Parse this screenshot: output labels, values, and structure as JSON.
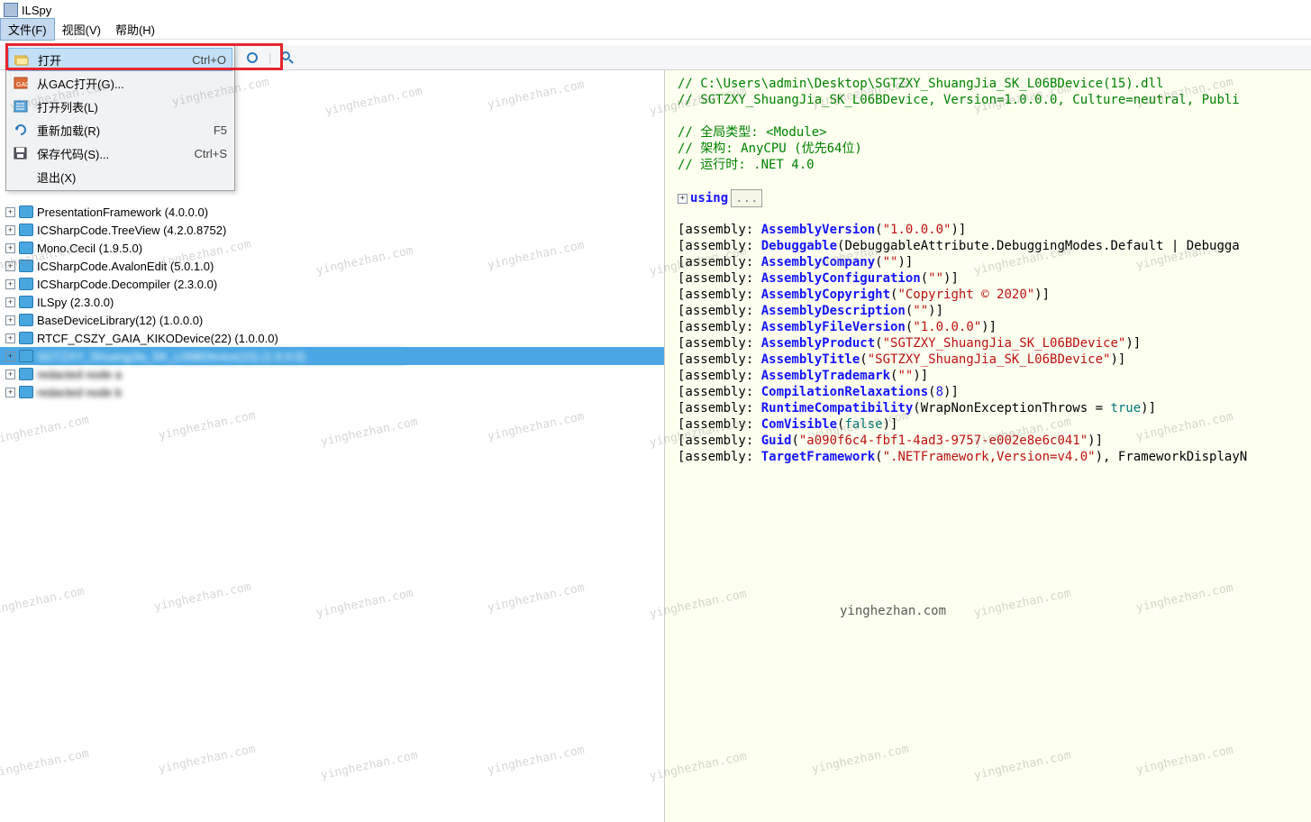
{
  "app": {
    "title": "ILSpy"
  },
  "menubar": {
    "items": [
      {
        "label": "文件(F)",
        "active": true
      },
      {
        "label": "视图(V)",
        "active": false
      },
      {
        "label": "帮助(H)",
        "active": false
      }
    ]
  },
  "fileMenu": {
    "items": [
      {
        "icon": "folder-open-icon",
        "label": "打开",
        "shortcut": "Ctrl+O",
        "hover": true
      },
      {
        "icon": "gac-icon",
        "label": "从GAC打开(G)...",
        "shortcut": ""
      },
      {
        "icon": "list-open-icon",
        "label": "打开列表(L)",
        "shortcut": ""
      },
      {
        "icon": "refresh-icon",
        "label": "重新加载(R)",
        "shortcut": "F5"
      },
      {
        "icon": "save-icon",
        "label": "保存代码(S)...",
        "shortcut": "Ctrl+S"
      },
      {
        "icon": "",
        "label": "退出(X)",
        "shortcut": ""
      }
    ]
  },
  "tree": {
    "nodes": [
      {
        "label": "PresentationFramework (4.0.0.0)",
        "state": "normal"
      },
      {
        "label": "ICSharpCode.TreeView (4.2.0.8752)",
        "state": "normal"
      },
      {
        "label": "Mono.Cecil (1.9.5.0)",
        "state": "normal"
      },
      {
        "label": "ICSharpCode.AvalonEdit (5.0.1.0)",
        "state": "normal"
      },
      {
        "label": "ICSharpCode.Decompiler (2.3.0.0)",
        "state": "normal"
      },
      {
        "label": "ILSpy (2.3.0.0)",
        "state": "normal"
      },
      {
        "label": "BaseDeviceLibrary(12) (1.0.0.0)",
        "state": "normal"
      },
      {
        "label": "RTCF_CSZY_GAIA_KIKODevice(22) (1.0.0.0)",
        "state": "normal"
      },
      {
        "label": "SGTZXY_ShuangJia_SK_L06BDevice(15) (1.0.0.0)",
        "state": "sel"
      },
      {
        "label": "redacted node a",
        "state": "blur"
      },
      {
        "label": "redacted node b",
        "state": "blur"
      }
    ]
  },
  "code": {
    "header": [
      "// C:\\Users\\admin\\Desktop\\SGTZXY_ShuangJia_SK_L06BDevice(15).dll",
      "// SGTZXY_ShuangJia_SK_L06BDevice, Version=1.0.0.0, Culture=neutral, Publi",
      "",
      "// 全局类型: <Module>",
      "// 架构: AnyCPU (优先64位)",
      "// 运行时: .NET 4.0"
    ],
    "usingWord": "using",
    "assemblyLines": [
      {
        "attr": "AssemblyVersion",
        "arg": "\"1.0.0.0\"",
        "argType": "str"
      },
      {
        "attr": "Debuggable",
        "argRaw": "(DebuggableAttribute.DebuggingModes.Default | Debugga"
      },
      {
        "attr": "AssemblyCompany",
        "arg": "\"\"",
        "argType": "str"
      },
      {
        "attr": "AssemblyConfiguration",
        "arg": "\"\"",
        "argType": "str"
      },
      {
        "attr": "AssemblyCopyright",
        "arg": "\"Copyright ©  2020\"",
        "argType": "str"
      },
      {
        "attr": "AssemblyDescription",
        "arg": "\"\"",
        "argType": "str"
      },
      {
        "attr": "AssemblyFileVersion",
        "arg": "\"1.0.0.0\"",
        "argType": "str"
      },
      {
        "attr": "AssemblyProduct",
        "arg": "\"SGTZXY_ShuangJia_SK_L06BDevice\"",
        "argType": "str"
      },
      {
        "attr": "AssemblyTitle",
        "arg": "\"SGTZXY_ShuangJia_SK_L06BDevice\"",
        "argType": "str"
      },
      {
        "attr": "AssemblyTrademark",
        "arg": "\"\"",
        "argType": "str"
      },
      {
        "attr": "CompilationRelaxations",
        "arg": "8",
        "argType": "num"
      },
      {
        "attr": "RuntimeCompatibility",
        "argRaw": "(WrapNonExceptionThrows = ",
        "tail_kw": "true",
        "tailClose": ")]"
      },
      {
        "attr": "ComVisible",
        "argKw": "false"
      },
      {
        "attr": "Guid",
        "arg": "\"a090f6c4-fbf1-4ad3-9757-e002e8e6c041\"",
        "argType": "str"
      },
      {
        "attr": "TargetFramework",
        "arg": "\".NETFramework,Version=v4.0\"",
        "argType": "str",
        "trailing": ", FrameworkDisplayN"
      }
    ]
  },
  "watermark": "yinghezhan.com"
}
